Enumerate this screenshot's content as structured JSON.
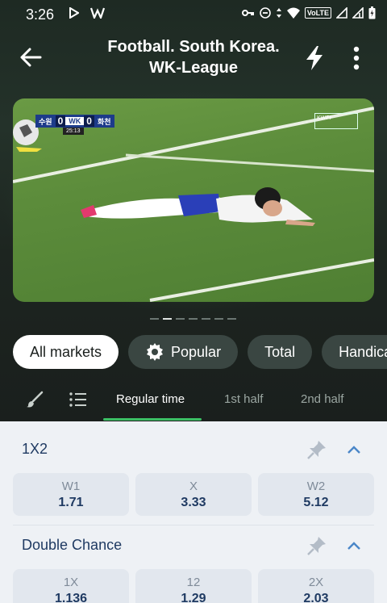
{
  "status_bar": {
    "time": "3:26",
    "icons_left": [
      "play-store-icon",
      "w-app-icon"
    ],
    "icons_right": [
      "key-icon",
      "dnd-icon",
      "data-arrows-icon",
      "wifi-icon",
      "signal-icon",
      "signal-icon",
      "battery-icon"
    ],
    "volte": "VoLTE"
  },
  "app_bar": {
    "title_line1": "Football. South Korea.",
    "title_line2": "WK-League"
  },
  "video": {
    "home_code": "수원",
    "home_score": "0",
    "away_score": "0",
    "away_code": "화천",
    "clock": "25:13",
    "broadcaster": "KWFF"
  },
  "carousel": {
    "count": 7,
    "active": 1
  },
  "chips": [
    {
      "label": "All markets",
      "active": true,
      "icon": ""
    },
    {
      "label": "Popular",
      "active": false,
      "icon": "gear-icon"
    },
    {
      "label": "Total",
      "active": false,
      "icon": ""
    },
    {
      "label": "Handica",
      "active": false,
      "icon": ""
    }
  ],
  "tabs": {
    "regular": "Regular time",
    "first_half": "1st half",
    "second_half": "2nd half"
  },
  "markets": {
    "x1x2": {
      "title": "1X2",
      "odds": [
        {
          "label": "W1",
          "value": "1.71"
        },
        {
          "label": "X",
          "value": "3.33"
        },
        {
          "label": "W2",
          "value": "5.12"
        }
      ]
    },
    "double_chance": {
      "title": "Double Chance",
      "odds": [
        {
          "label": "1X",
          "value": "1.136"
        },
        {
          "label": "12",
          "value": "1.29"
        },
        {
          "label": "2X",
          "value": "2.03"
        }
      ]
    }
  },
  "colors": {
    "accent_green": "#3bbf64",
    "market_text": "#1f3a62",
    "odd_bg": "#e2e7ee"
  }
}
